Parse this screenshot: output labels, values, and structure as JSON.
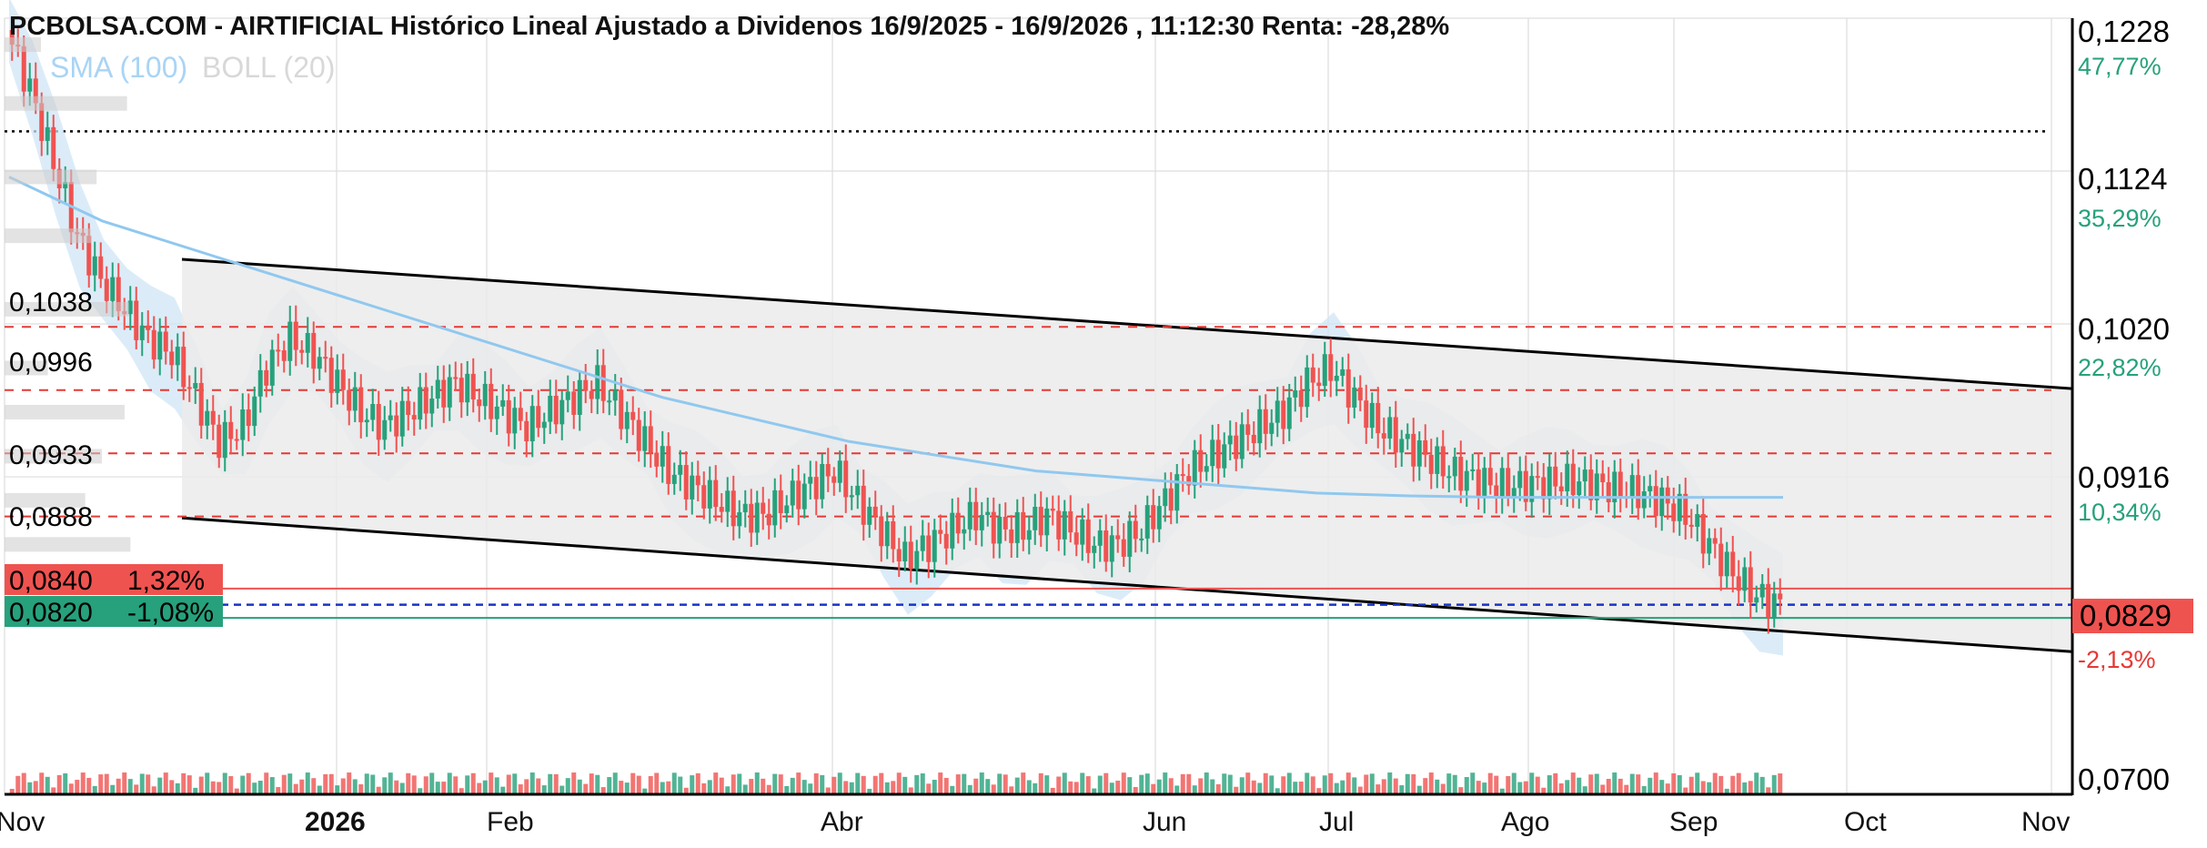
{
  "header": {
    "title": "PCBOLSA.COM - AIRTIFICIAL Histórico Lineal Ajustado a Dividenos 16/9/2025 - 16/9/2026 , 11:12:30 Renta: -28,28%"
  },
  "indicators": {
    "sma": "SMA (100)",
    "boll": "BOLL (20)"
  },
  "colors": {
    "up": "#26a17b",
    "down": "#ef5350",
    "sma": "#90c8ef",
    "band": "#cfe6f5",
    "channel": "#ebebeb",
    "grid": "#dddddd",
    "pct_up": "#26a17b",
    "pct_down": "#e53935"
  },
  "chart_data": {
    "type": "candlestick",
    "x_axis": {
      "labels": [
        "Nov",
        "2026",
        "Feb",
        "Abr",
        "Jun",
        "Jul",
        "Ago",
        "Sep",
        "Oct",
        "Nov"
      ],
      "bold": [
        "2026"
      ]
    },
    "y_axis": {
      "ticks": [
        "0,1228",
        "0,1124",
        "0,1020",
        "0,0916",
        "0,0700"
      ],
      "percent_ticks": [
        {
          "label": "47,77%",
          "color": "up"
        },
        {
          "label": "35,29%",
          "color": "up"
        },
        {
          "label": "22,82%",
          "color": "up"
        },
        {
          "label": "10,34%",
          "color": "up"
        },
        {
          "label": "-2,13%",
          "color": "down"
        }
      ],
      "range": [
        0.07,
        0.1228
      ],
      "current_price": "0,0829"
    },
    "level_labels": [
      "0,1038",
      "0,0996",
      "0,0933",
      "0,0888"
    ],
    "boxes": [
      {
        "price": "0,0840",
        "pct": "1,32%",
        "color": "down"
      },
      {
        "price": "0,0820",
        "pct": "-1,08%",
        "color": "up"
      }
    ],
    "resistance_lines": [
      0.1018,
      0.0975,
      0.0932,
      0.0889
    ],
    "dotted_line": 0.1151,
    "channel": {
      "upper": [
        0.1064,
        0.0976
      ],
      "lower": [
        0.0888,
        0.0797
      ]
    },
    "price_path": [
      0.122,
      0.118,
      0.113,
      0.108,
      0.105,
      0.103,
      0.101,
      0.1,
      0.097,
      0.094,
      0.095,
      0.099,
      0.101,
      0.1,
      0.098,
      0.096,
      0.095,
      0.096,
      0.097,
      0.098,
      0.097,
      0.096,
      0.095,
      0.096,
      0.097,
      0.098,
      0.096,
      0.094,
      0.092,
      0.091,
      0.09,
      0.089,
      0.089,
      0.09,
      0.091,
      0.092,
      0.09,
      0.088,
      0.086,
      0.087,
      0.088,
      0.089,
      0.088,
      0.088,
      0.089,
      0.088,
      0.087,
      0.087,
      0.088,
      0.09,
      0.092,
      0.093,
      0.094,
      0.095,
      0.096,
      0.098,
      0.099,
      0.097,
      0.095,
      0.094,
      0.093,
      0.092,
      0.0915,
      0.091,
      0.091,
      0.0912,
      0.0913,
      0.0912,
      0.0908,
      0.0905,
      0.09,
      0.089,
      0.087,
      0.085,
      0.0835,
      0.0829
    ],
    "sma_path": [
      0.112,
      0.109,
      0.107,
      0.105,
      0.103,
      0.101,
      0.099,
      0.097,
      0.0955,
      0.094,
      0.093,
      0.092,
      0.0915,
      0.091,
      0.0905,
      0.0903,
      0.0902,
      0.0902,
      0.0902,
      0.0902
    ],
    "sma_x_end": "16/9/2026"
  }
}
